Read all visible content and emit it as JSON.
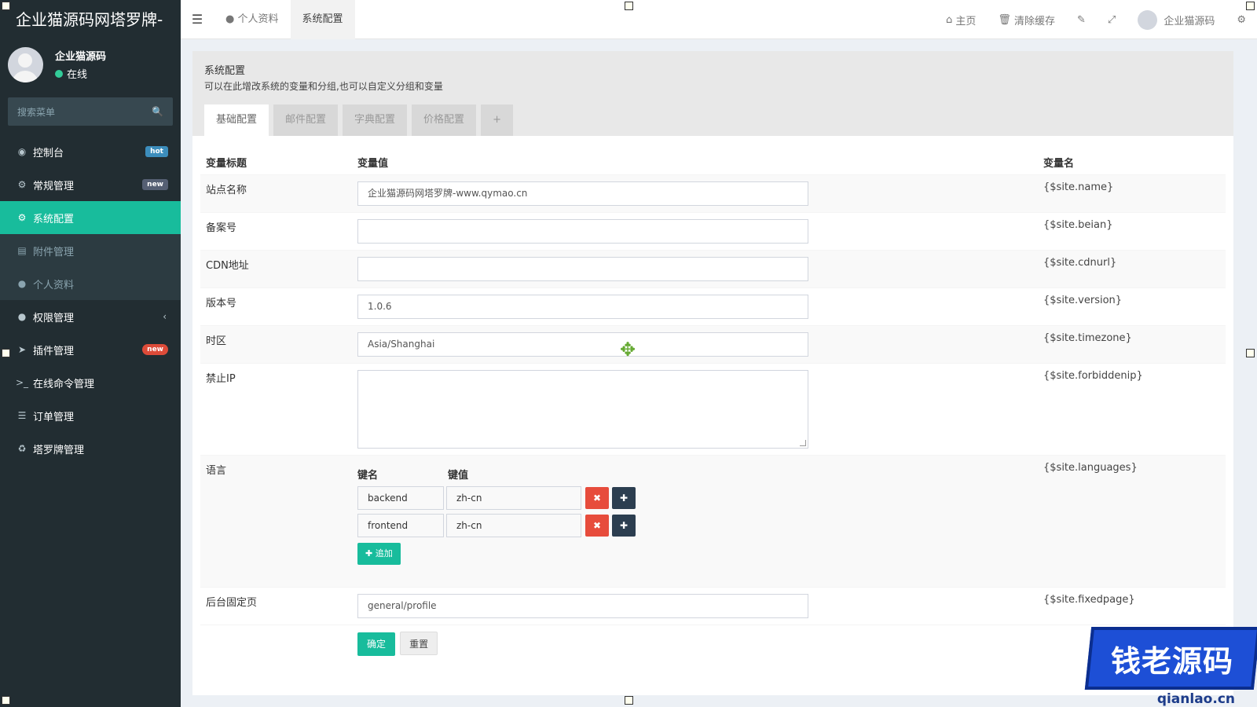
{
  "app": {
    "logo_title": "企业猫源码网塔罗牌-",
    "user_name": "企业猫源码",
    "user_status": "在线",
    "search_placeholder": "搜索菜单"
  },
  "sidebar": {
    "items": [
      {
        "label": "控制台",
        "icon": "dashboard-icon",
        "badge": "hot"
      },
      {
        "label": "常规管理",
        "icon": "cogs-icon",
        "badge": "new"
      },
      {
        "label": "系统配置",
        "icon": "gear-icon"
      },
      {
        "label": "附件管理",
        "icon": "file-icon"
      },
      {
        "label": "个人资料",
        "icon": "user-icon"
      },
      {
        "label": "权限管理",
        "icon": "group-icon",
        "chevron": "‹"
      },
      {
        "label": "插件管理",
        "icon": "rocket-icon",
        "badge": "new"
      },
      {
        "label": "在线命令管理",
        "icon": "terminal-icon"
      },
      {
        "label": "订单管理",
        "icon": "list-icon"
      },
      {
        "label": "塔罗牌管理",
        "icon": "recycle-icon"
      }
    ]
  },
  "header": {
    "tabs": [
      "个人资料",
      "系统配置"
    ],
    "home": "主页",
    "clear_cache": "清除缓存",
    "user": "企业猫源码"
  },
  "panel": {
    "title": "系统配置",
    "subtitle": "可以在此增改系统的变量和分组,也可以自定义分组和变量",
    "tabs": [
      "基础配置",
      "邮件配置",
      "字典配置",
      "价格配置",
      "+"
    ]
  },
  "table": {
    "headers": [
      "变量标题",
      "变量值",
      "变量名"
    ],
    "rows": [
      {
        "title": "站点名称",
        "value": "企业猫源码网塔罗牌-www.qymao.cn",
        "var": "{$site.name}"
      },
      {
        "title": "备案号",
        "value": "",
        "var": "{$site.beian}"
      },
      {
        "title": "CDN地址",
        "value": "",
        "var": "{$site.cdnurl}"
      },
      {
        "title": "版本号",
        "value": "1.0.6",
        "var": "{$site.version}"
      },
      {
        "title": "时区",
        "value": "Asia/Shanghai",
        "var": "{$site.timezone}"
      },
      {
        "title": "禁止IP",
        "value": "",
        "var": "{$site.forbiddenip}"
      },
      {
        "title": "语言",
        "var": "{$site.languages}"
      },
      {
        "title": "后台固定页",
        "value": "general/profile",
        "var": "{$site.fixedpage}"
      }
    ],
    "languages": {
      "key_header": "键名",
      "value_header": "键值",
      "pairs": [
        {
          "key": "backend",
          "value": "zh-cn"
        },
        {
          "key": "frontend",
          "value": "zh-cn"
        }
      ],
      "add_label": "追加"
    },
    "submit_label": "确定",
    "reset_label": "重置"
  },
  "watermark": {
    "text": "钱老源码",
    "url": "qianlao.cn"
  }
}
